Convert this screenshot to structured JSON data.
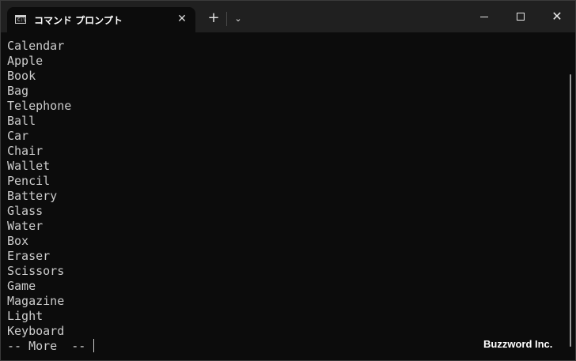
{
  "window": {
    "tab_title": "コマンド プロンプト",
    "tab_icon_text": "C:\\",
    "tab_close_glyph": "✕",
    "new_tab_glyph": "+",
    "dropdown_glyph": "⌄",
    "close_glyph": "✕"
  },
  "console": {
    "lines": [
      "Calendar",
      "Apple",
      "Book",
      "Bag",
      "Telephone",
      "Ball",
      "Car",
      "Chair",
      "Wallet",
      "Pencil",
      "Battery",
      "Glass",
      "Water",
      "Box",
      "Eraser",
      "Scissors",
      "Game",
      "Magazine",
      "Light",
      "Keyboard"
    ],
    "prompt": "-- More  -- "
  },
  "watermark": "Buzzword Inc.",
  "colors": {
    "console_bg": "#0c0c0c",
    "titlebar_bg": "#202020",
    "text": "#cccccc"
  }
}
